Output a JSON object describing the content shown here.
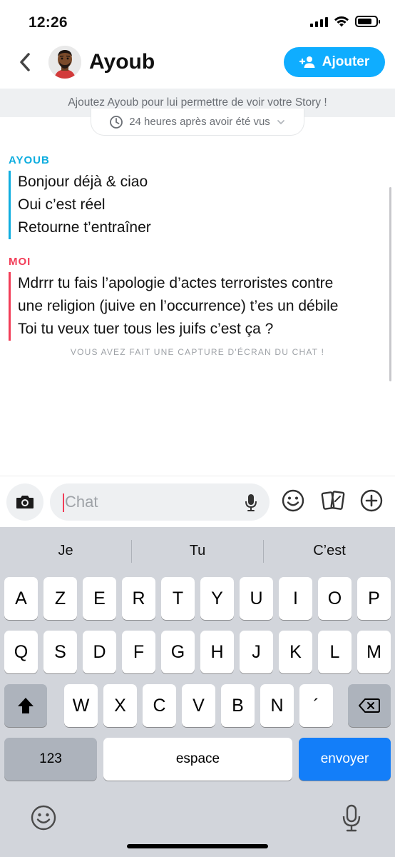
{
  "status_bar": {
    "time": "12:26"
  },
  "header": {
    "back_icon": "chevron-left-icon",
    "contact_name": "Ayoub",
    "add_button_label": "Ajouter",
    "add_button_icon": "add-friend-icon",
    "accent_color": "#0fadff"
  },
  "banner": {
    "text": "Ajoutez Ayoub pour lui permettre de voir votre Story !",
    "timer_label": "24 heures après avoir été vus"
  },
  "messages": [
    {
      "sender": "AYOUB",
      "color": "#0eaddf",
      "lines": [
        "Bonjour déjà & ciao",
        "Oui c’est réel",
        "Retourne t’entraîner"
      ]
    },
    {
      "sender": "MOI",
      "color": "#f23c57",
      "lines": [
        "Mdrrr tu fais l’apologie d’actes terroristes contre",
        "une religion (juive en l’occurrence) t’es un débile",
        "Toi tu veux tuer tous les juifs c’est ça ?"
      ]
    }
  ],
  "screenshot_notice": "VOUS AVEZ FAIT UNE CAPTURE D'ÉCRAN DU CHAT !",
  "input_bar": {
    "placeholder": "Chat",
    "value": "",
    "icons": [
      "camera-icon",
      "microphone-icon",
      "smiley-icon",
      "cards-icon",
      "plus-icon"
    ]
  },
  "keyboard": {
    "suggestions": [
      "Je",
      "Tu",
      "C’est"
    ],
    "row1": [
      "A",
      "Z",
      "E",
      "R",
      "T",
      "Y",
      "U",
      "I",
      "O",
      "P"
    ],
    "row2": [
      "Q",
      "S",
      "D",
      "F",
      "G",
      "H",
      "J",
      "K",
      "L",
      "M"
    ],
    "row3": [
      "W",
      "X",
      "C",
      "V",
      "B",
      "N",
      "´"
    ],
    "numbers_key": "123",
    "space_key": "espace",
    "send_key": "envoyer"
  }
}
